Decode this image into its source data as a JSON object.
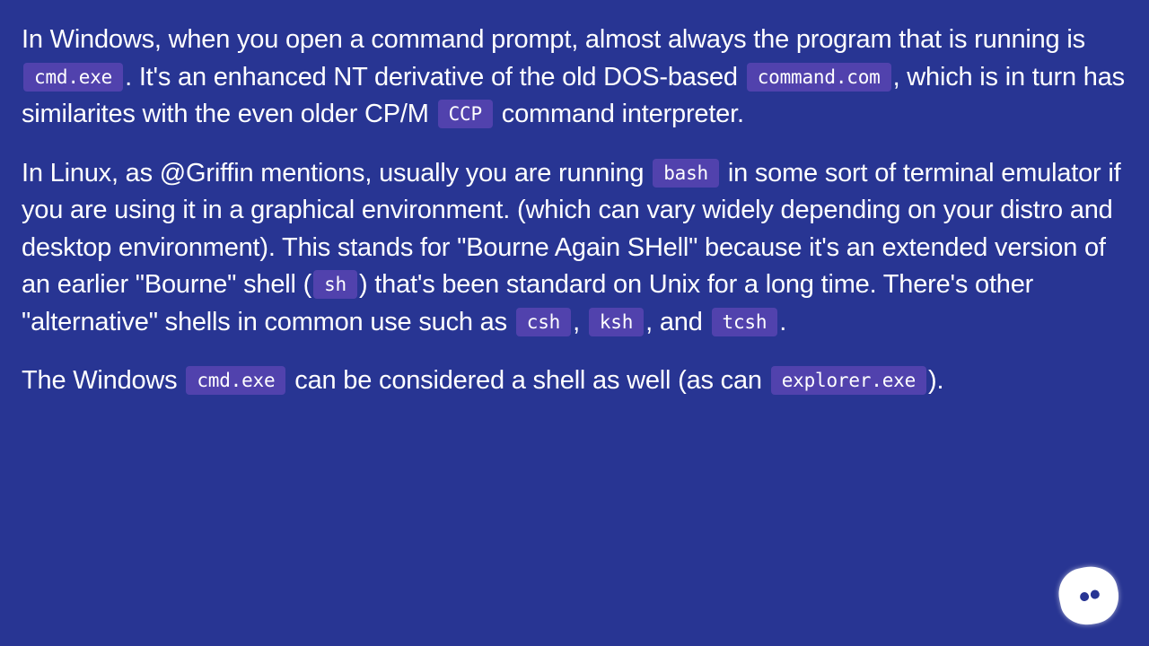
{
  "colors": {
    "background": "#283593",
    "code_chip": "#5142ad",
    "text": "#ffffff"
  },
  "paragraphs": [
    {
      "segments": [
        {
          "type": "text",
          "value": "In Windows, when you open a command prompt, almost always the program that is running is "
        },
        {
          "type": "code",
          "value": "cmd.exe"
        },
        {
          "type": "text",
          "value": ". It's an enhanced NT derivative of the old DOS-based "
        },
        {
          "type": "code",
          "value": "command.com"
        },
        {
          "type": "text",
          "value": ", which is in turn has similarites with the even older CP/M "
        },
        {
          "type": "code",
          "value": "CCP"
        },
        {
          "type": "text",
          "value": " command interpreter."
        }
      ]
    },
    {
      "segments": [
        {
          "type": "text",
          "value": "In Linux, as @Griffin mentions, usually you are running "
        },
        {
          "type": "code",
          "value": "bash"
        },
        {
          "type": "text",
          "value": " in some sort of terminal emulator if you are using it in a graphical environment. (which can vary widely depending on your distro and desktop environment). This stands for \"Bourne Again SHell\" because it's an extended version of an earlier \"Bourne\" shell ("
        },
        {
          "type": "code",
          "value": "sh"
        },
        {
          "type": "text",
          "value": ") that's been standard on Unix for a long time. There's other \"alternative\" shells in common use such as "
        },
        {
          "type": "code",
          "value": "csh"
        },
        {
          "type": "text",
          "value": ", "
        },
        {
          "type": "code",
          "value": "ksh"
        },
        {
          "type": "text",
          "value": ", and "
        },
        {
          "type": "code",
          "value": "tcsh"
        },
        {
          "type": "text",
          "value": "."
        }
      ]
    },
    {
      "segments": [
        {
          "type": "text",
          "value": "The Windows "
        },
        {
          "type": "code",
          "value": "cmd.exe"
        },
        {
          "type": "text",
          "value": " can be considered a shell as well (as can "
        },
        {
          "type": "code",
          "value": "explorer.exe"
        },
        {
          "type": "text",
          "value": ")."
        }
      ]
    }
  ],
  "chat_button": {
    "icon": "chat-bubble-eyes-icon"
  }
}
